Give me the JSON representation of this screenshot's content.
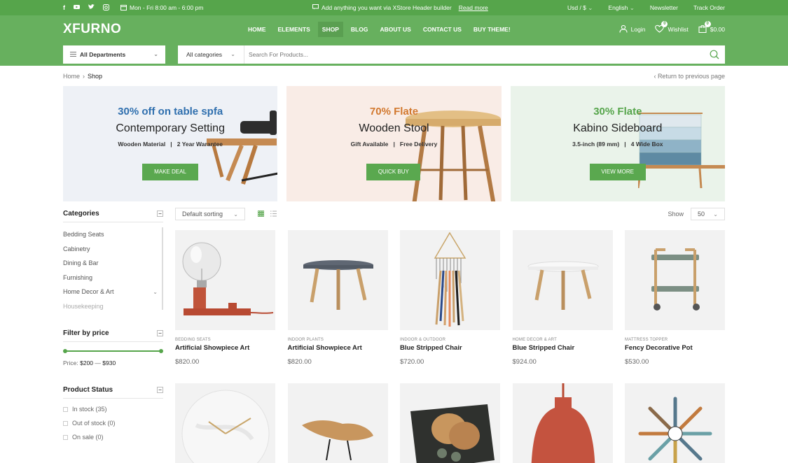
{
  "topbar": {
    "social_icons": [
      "facebook-icon",
      "youtube-icon",
      "twitter-icon",
      "instagram-icon"
    ],
    "hours": "Mon - Fri 8:00 am - 6:00 pm",
    "promo_text": "Add anything you want via XStore Header builder",
    "promo_link": "Read more",
    "currency": "Usd / $",
    "language": "English",
    "newsletter": "Newsletter",
    "track_order": "Track Order"
  },
  "header": {
    "logo": "XFURNO",
    "nav": [
      {
        "label": "HOME"
      },
      {
        "label": "ELEMENTS"
      },
      {
        "label": "SHOP",
        "active": true
      },
      {
        "label": "BLOG"
      },
      {
        "label": "ABOUT US"
      },
      {
        "label": "CONTACT US"
      },
      {
        "label": "BUY THEME!"
      }
    ],
    "login": "Login",
    "wishlist": "Wishlist",
    "wishlist_count": "0",
    "cart_total": "$0.00",
    "cart_count": "0"
  },
  "search": {
    "departments": "All Departments",
    "category": "All categories",
    "placeholder": "Search For Products..."
  },
  "breadcrumb": {
    "home": "Home",
    "current": "Shop",
    "back": "Return to previous page"
  },
  "banners": [
    {
      "off": "30% off on table spfa",
      "title": "Contemporary Setting",
      "sub_a": "Wooden Material",
      "sub_b": "2 Year Warantee",
      "cta": "MAKE DEAL",
      "accent": "#2f6fae",
      "bg": "#eef1f6"
    },
    {
      "off": "70% Flate",
      "title": "Wooden Stool",
      "sub_a": "Gift Available",
      "sub_b": "Free Delivery",
      "cta": "QUICK BUY",
      "accent": "#d2782e",
      "bg": "#f9ece6"
    },
    {
      "off": "30% Flate",
      "title": "Kabino Sideboard",
      "sub_a": "3.5-inch (89 mm)",
      "sub_b": "4 Wide Box",
      "cta": "VIEW MORE",
      "accent": "#56a54b",
      "bg": "#eaf3ea"
    }
  ],
  "sidebar": {
    "categories_title": "Categories",
    "categories": [
      "Bedding Seats",
      "Cabinetry",
      "Dining & Bar",
      "Furnishing",
      "Home Decor & Art",
      "Housekeeping"
    ],
    "price_title": "Filter by price",
    "price_label": "Price:",
    "price_min": "$200",
    "price_max": "$930",
    "status_title": "Product Status",
    "status": [
      "In stock (35)",
      "Out of stock (0)",
      "On sale (0)"
    ]
  },
  "toolbar": {
    "sort": "Default sorting",
    "show_label": "Show",
    "show_value": "50"
  },
  "products": [
    {
      "category": "BEDDING SEATS",
      "name": "Artificial Showpiece Art",
      "price": "$820.00"
    },
    {
      "category": "INDOOR PLANTS",
      "name": "Artificial Showpiece Art",
      "price": "$820.00"
    },
    {
      "category": "INDOOR & OUTDOOR",
      "name": "Blue Stripped Chair",
      "price": "$720.00"
    },
    {
      "category": "HOME DECOR & ART",
      "name": "Blue Stripped Chair",
      "price": "$924.00"
    },
    {
      "category": "MATTRESS TOPPER",
      "name": "Fency Decorative Pot",
      "price": "$530.00"
    }
  ],
  "colors": {
    "brand": "#56a54b",
    "brand_light": "#67b05e"
  }
}
